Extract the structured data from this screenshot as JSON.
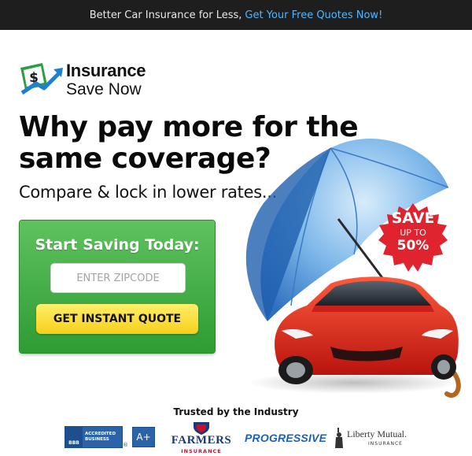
{
  "topbar": {
    "message": "Better Car Insurance for Less,",
    "cta": "Get Your Free Quotes Now!"
  },
  "logo": {
    "line1": "Insurance",
    "line2": "Save Now"
  },
  "hero": {
    "headline": "Why pay more for the same coverage?",
    "subhead": "Compare & lock in lower rates..."
  },
  "badge": {
    "line1": "SAVE",
    "line2": "UP TO",
    "line3": "50%"
  },
  "form": {
    "title": "Start Saving Today:",
    "zip_placeholder": "ENTER ZIPCODE",
    "zip_value": "",
    "button_label": "GET INSTANT QUOTE"
  },
  "trust": {
    "title": "Trusted by the Industry",
    "bbb_text": "ACCREDITED BUSINESS",
    "bbb_abbr": "BBB",
    "bbb_rating": "A+",
    "farmers": "FARMERS",
    "farmers_sub": "INSURANCE",
    "progressive": "PROGRESSIVE",
    "liberty": "Liberty Mutual.",
    "liberty_sub": "INSURANCE"
  },
  "colors": {
    "topbar_bg": "#1e1e1e",
    "cta": "#4fb6ff",
    "form_green": "#3fae43",
    "button_yellow": "#f9dc3a",
    "badge_red": "#e0242f"
  }
}
